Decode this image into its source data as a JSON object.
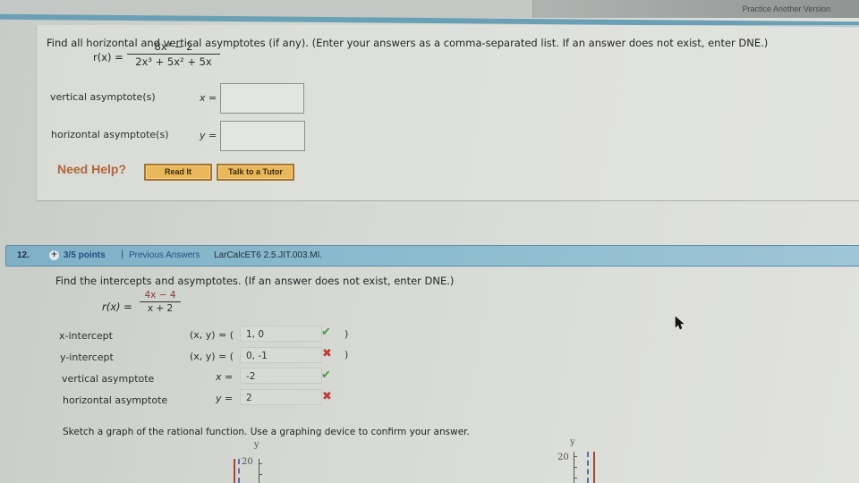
{
  "top": {
    "practice_link": "Practice Another Version"
  },
  "q11": {
    "prompt": "Find all horizontal and vertical asymptotes (if any). (Enter your answers as a comma-separated list. If an answer does not exist, enter DNE.)",
    "function_lhs": "r(x) =",
    "numerator": "8x³ − 2",
    "denominator": "2x³ + 5x² + 5x",
    "vertical_label": "vertical asymptote(s)",
    "vertical_eq": "x =",
    "vertical_value": "",
    "horizontal_label": "horizontal asymptote(s)",
    "horizontal_eq": "y =",
    "horizontal_value": "",
    "need_help": "Need Help?",
    "read_it": "Read It",
    "talk_tutor": "Talk to a Tutor"
  },
  "q12": {
    "number": "12.",
    "plus": "+",
    "points": "3/5 points",
    "separator": "|",
    "previous_answers": "Previous Answers",
    "code": "LarCalcET6 2.5.JIT.003.MI.",
    "prompt": "Find the intercepts and asymptotes. (If an answer does not exist, enter DNE.)",
    "function_lhs": "r(x) =",
    "numerator": "4x − 4",
    "denominator": "x + 2",
    "rows": [
      {
        "label": "x-intercept",
        "eq": "(x, y) = (",
        "value": "1, 0",
        "status": "correct",
        "close": ")"
      },
      {
        "label": "y-intercept",
        "eq": "(x, y) = (",
        "value": "0, -1",
        "status": "incorrect",
        "close": ")"
      },
      {
        "label": "vertical asymptote",
        "eq": "x =",
        "value": "-2",
        "status": "correct",
        "close": ""
      },
      {
        "label": "horizontal asymptote",
        "eq": "y =",
        "value": "2",
        "status": "incorrect",
        "close": ""
      }
    ],
    "check_glyph": "✔",
    "cross_glyph": "✖",
    "sketch_prompt": "Sketch a graph of the rational function. Use a graphing device to confirm your answer.",
    "graphs": [
      {
        "axis_label": "y",
        "tick_label": "20"
      },
      {
        "axis_label": "y",
        "tick_label": "20"
      }
    ]
  }
}
